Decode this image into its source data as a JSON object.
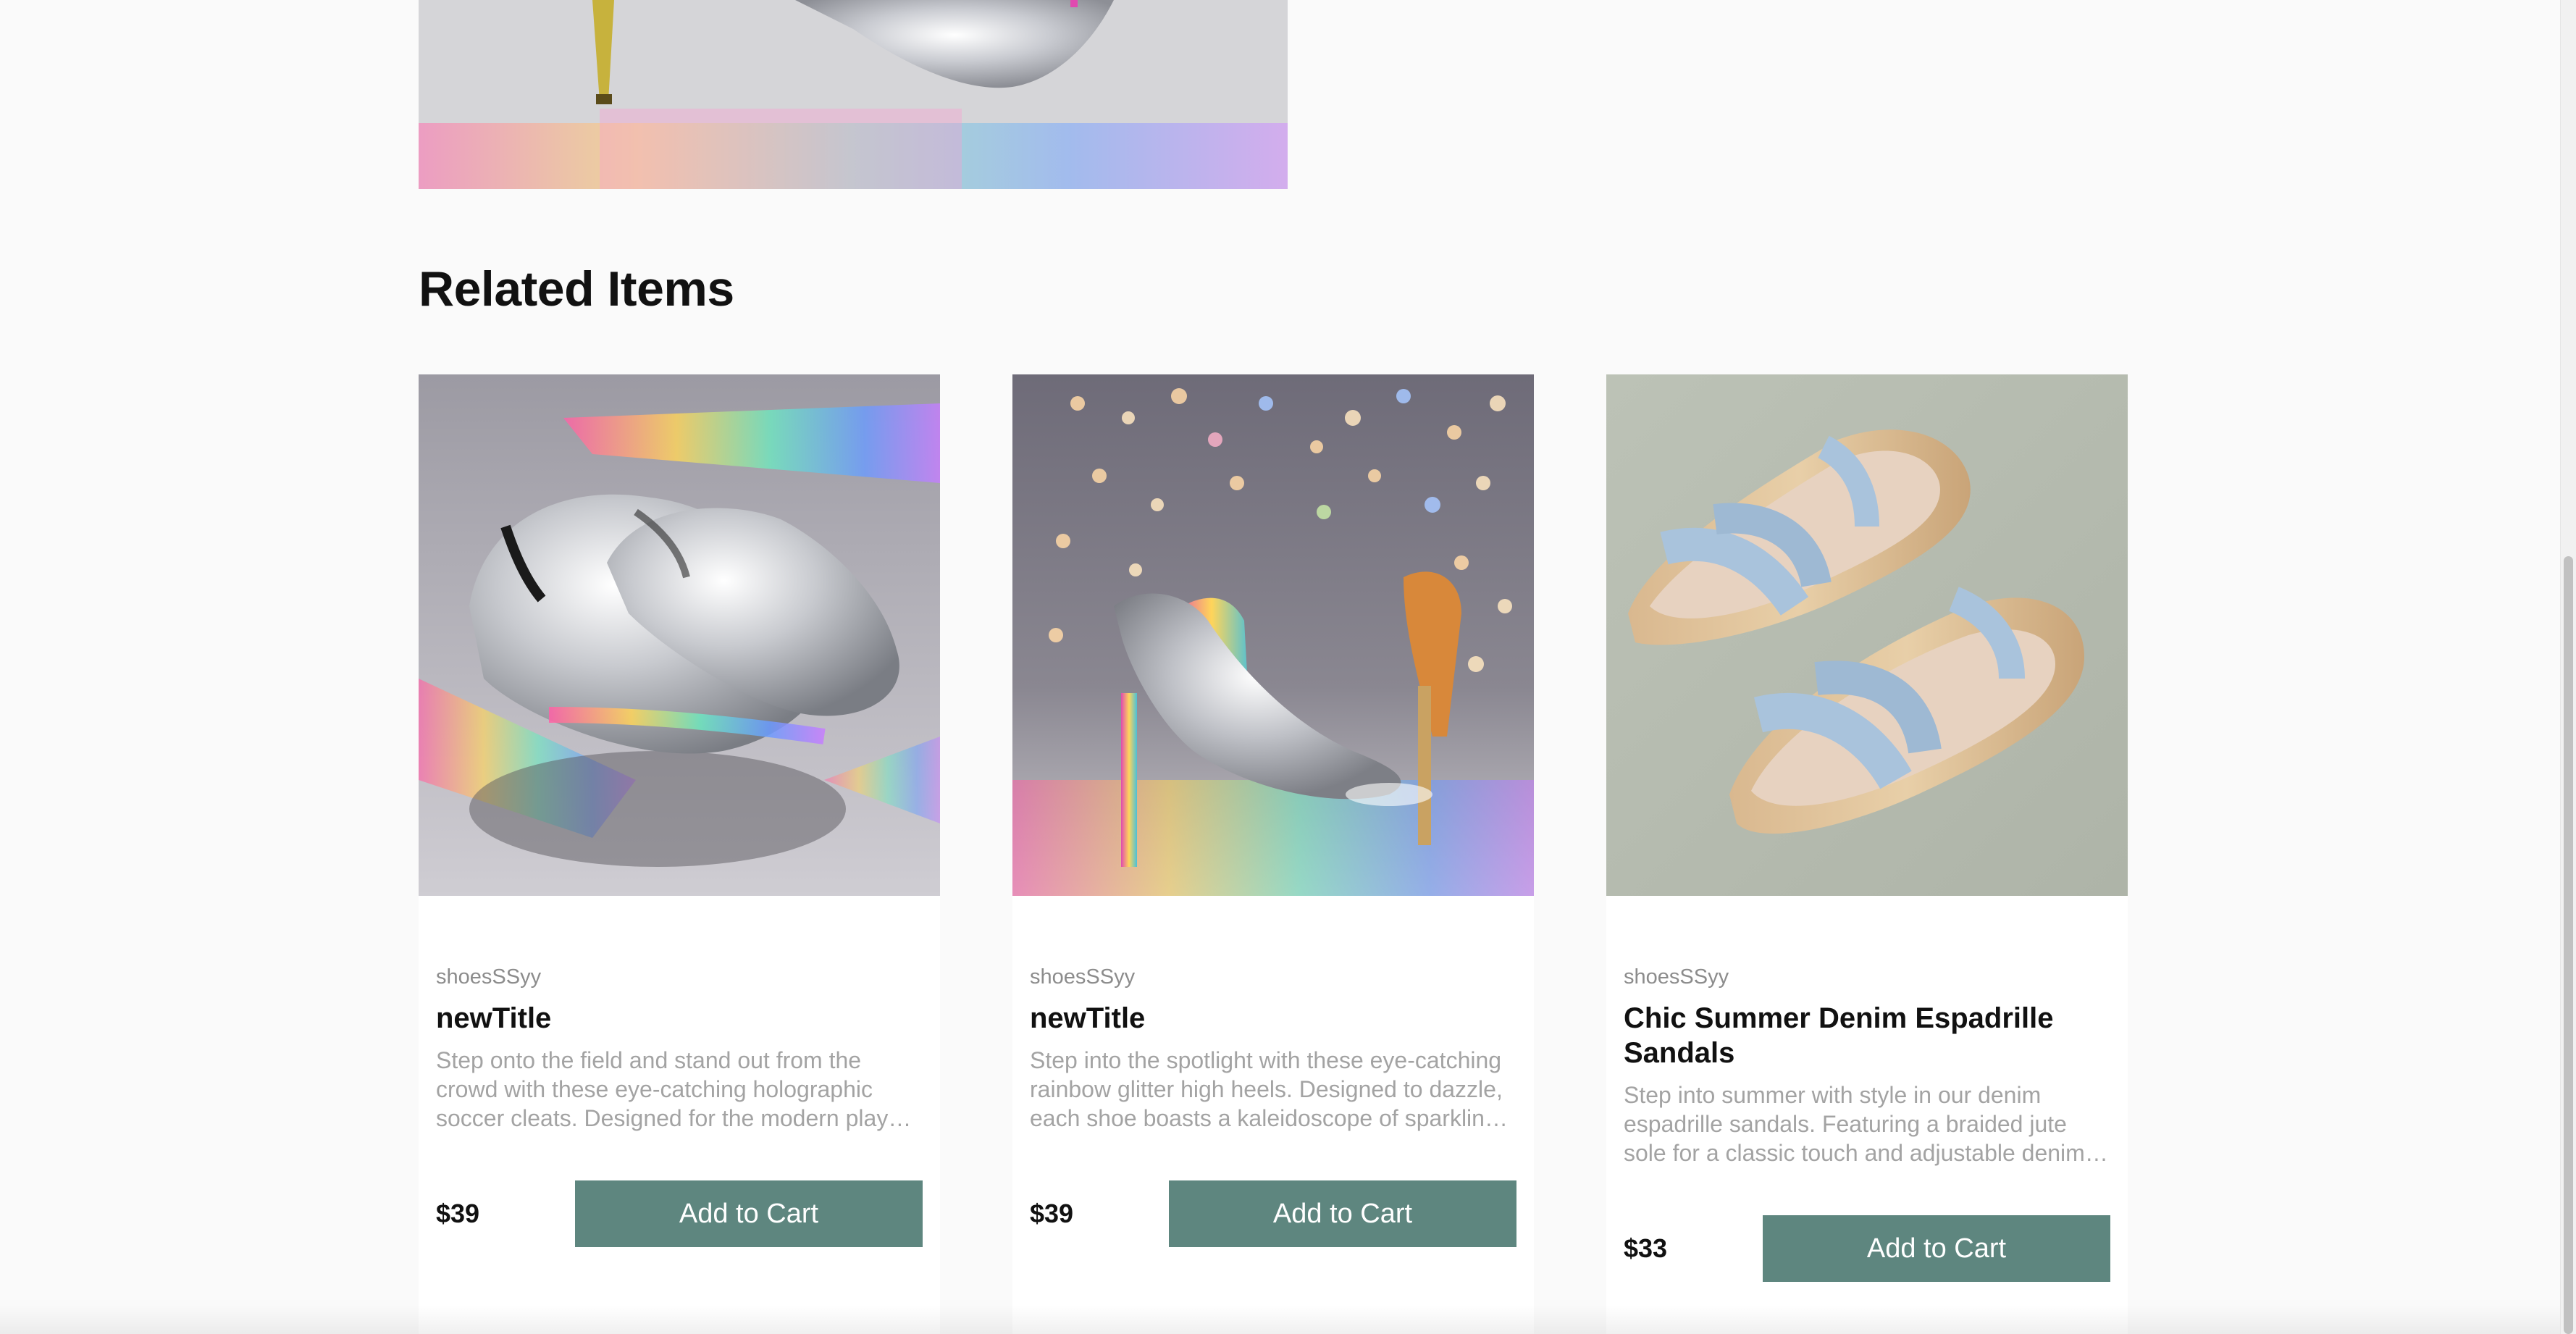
{
  "hero": {
    "image_alt_icon": "glitter-heel-image"
  },
  "related": {
    "title": "Related Items",
    "items": [
      {
        "category": "shoesSSyy",
        "title": "newTitle",
        "description": "Step onto the field and stand out from the crowd with these eye-catching holographic soccer cleats. Designed for the modern player who wants to shine on and off the pitch.",
        "price": "$39",
        "button_label": "Add to Cart",
        "image_icon": "holographic-cleats-image"
      },
      {
        "category": "shoesSSyy",
        "title": "newTitle",
        "description": "Step into the spotlight with these eye-catching rainbow glitter high heels. Designed to dazzle, each shoe boasts a kaleidoscope of sparkling colors.",
        "price": "$39",
        "button_label": "Add to Cart",
        "image_icon": "rainbow-glitter-heels-image"
      },
      {
        "category": "shoesSSyy",
        "title": "Chic Summer Denim Espadrille Sandals",
        "description": "Step into summer with style in our denim espadrille sandals. Featuring a braided jute sole for a classic touch and adjustable denim straps.",
        "price": "$33",
        "button_label": "Add to Cart",
        "image_icon": "denim-espadrille-sandals-image"
      }
    ]
  },
  "colors": {
    "background": "#fafafa",
    "button": "#5e867f",
    "muted_text": "#a3a3a3"
  }
}
